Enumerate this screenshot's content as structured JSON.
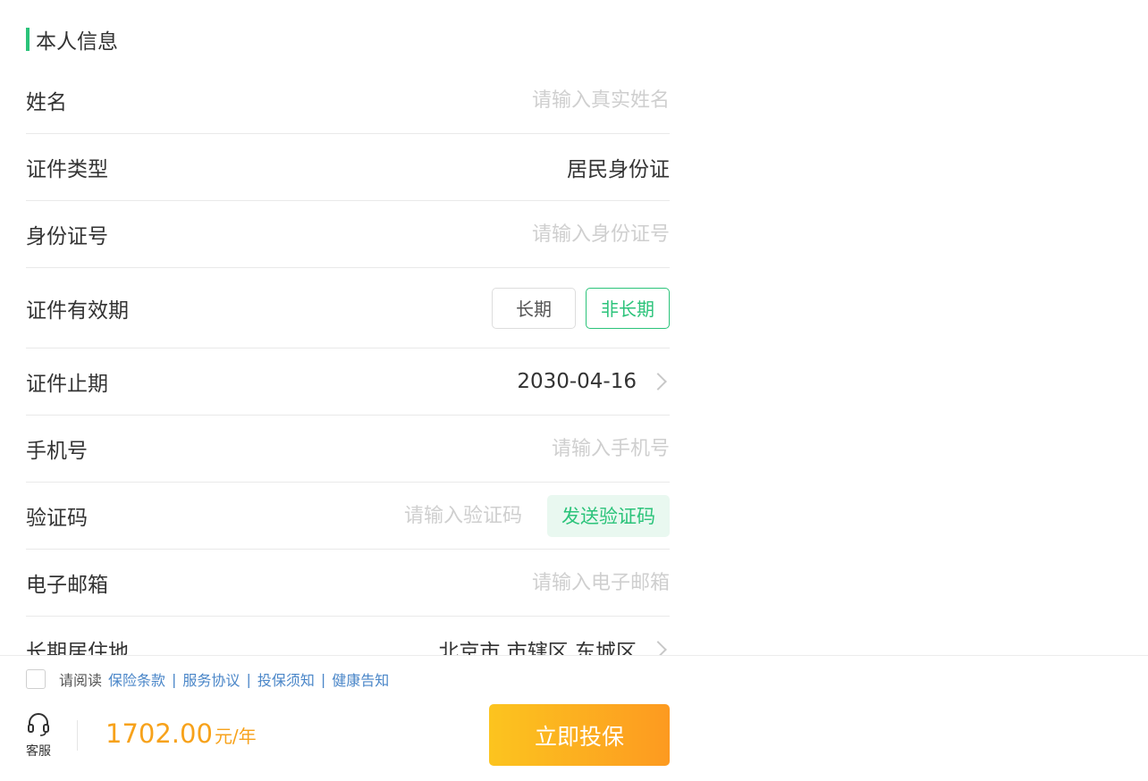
{
  "section": {
    "title": "本人信息"
  },
  "form": {
    "name": {
      "label": "姓名",
      "placeholder": "请输入真实姓名"
    },
    "id_type": {
      "label": "证件类型",
      "value": "居民身份证"
    },
    "id_number": {
      "label": "身份证号",
      "placeholder": "请输入身份证号"
    },
    "validity": {
      "label": "证件有效期",
      "options": [
        "长期",
        "非长期"
      ],
      "selected": "非长期"
    },
    "expiry": {
      "label": "证件止期",
      "value": "2030-04-16"
    },
    "phone": {
      "label": "手机号",
      "placeholder": "请输入手机号"
    },
    "code": {
      "label": "验证码",
      "placeholder": "请输入验证码",
      "button": "发送验证码"
    },
    "email": {
      "label": "电子邮箱",
      "placeholder": "请输入电子邮箱"
    },
    "residence": {
      "label": "长期居住地",
      "value": "北京市 市辖区 东城区"
    }
  },
  "footer": {
    "agree_prefix": "请阅读",
    "links": [
      "保险条款",
      "服务协议",
      "投保须知",
      "健康告知"
    ],
    "separator": "|",
    "service_label": "客服",
    "service_icon": "headset-icon",
    "price": "1702.00",
    "price_unit": "元/年",
    "buy_label": "立即投保"
  },
  "colors": {
    "accent": "#2bc37a",
    "price": "#f7a21b",
    "link": "#4a86c8"
  }
}
